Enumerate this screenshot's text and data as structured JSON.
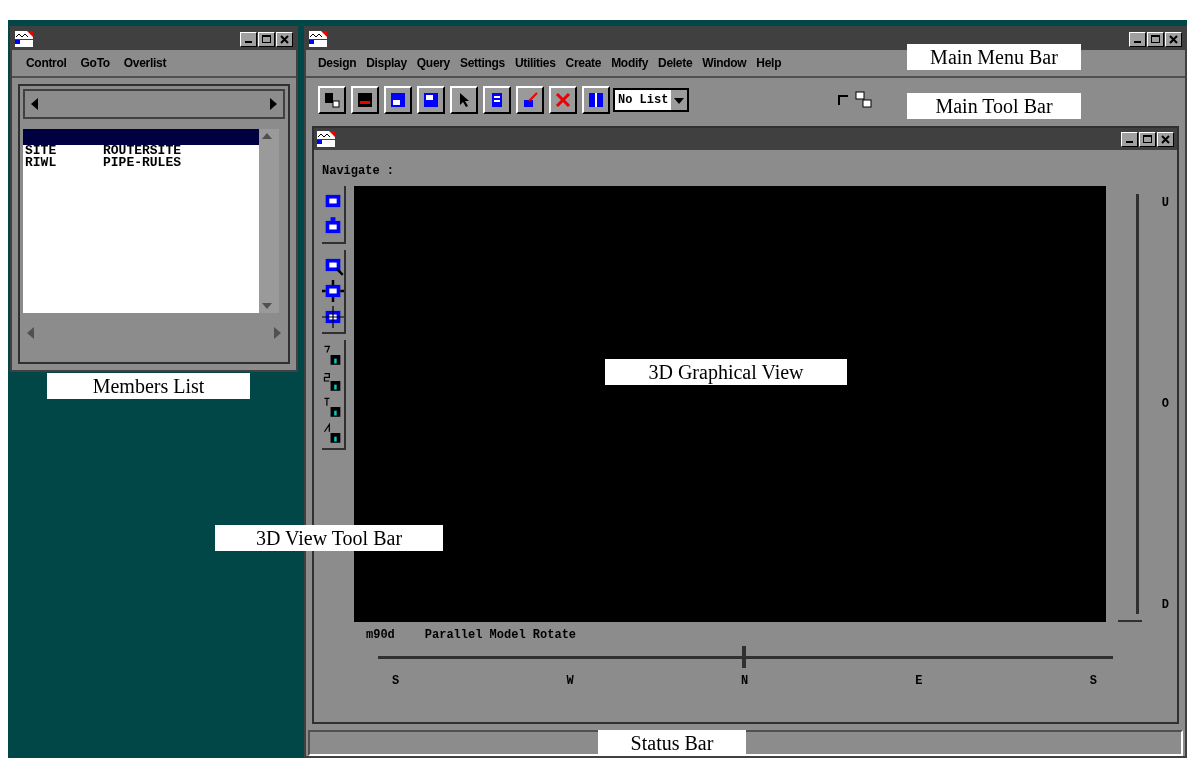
{
  "members_window": {
    "menu": [
      "Control",
      "GoTo",
      "Overlist"
    ],
    "list": {
      "top_row_selected": true,
      "rows": [
        {
          "col_1": "SITE",
          "col_2": "ROUTERSITE"
        },
        {
          "col_1": "RIWL",
          "col_2": "PIPE-RULES"
        }
      ]
    }
  },
  "main_window": {
    "menu": [
      "Design",
      "Display",
      "Query",
      "Settings",
      "Utilities",
      "Create",
      "Modify",
      "Delete",
      "Window",
      "Help"
    ],
    "toolbar": {
      "list_combo": "No List",
      "checkbox_checked": false
    }
  },
  "view_window": {
    "label": "Navigate :",
    "code": "m90d",
    "mode": "Parallel Model Rotate",
    "elevation": {
      "labels": [
        "U",
        "O",
        "D"
      ],
      "level": 0
    },
    "bearing": {
      "labels": [
        "S",
        "W",
        "N",
        "E",
        "S"
      ],
      "level": 0.5
    }
  },
  "annotations": [
    {
      "text": "Main Menu Bar"
    },
    {
      "text": "Main Tool Bar"
    },
    {
      "text": "Members List"
    },
    {
      "text": "3D Graphical View"
    },
    {
      "text": "3D View Tool Bar"
    },
    {
      "text": "Status Bar"
    }
  ]
}
